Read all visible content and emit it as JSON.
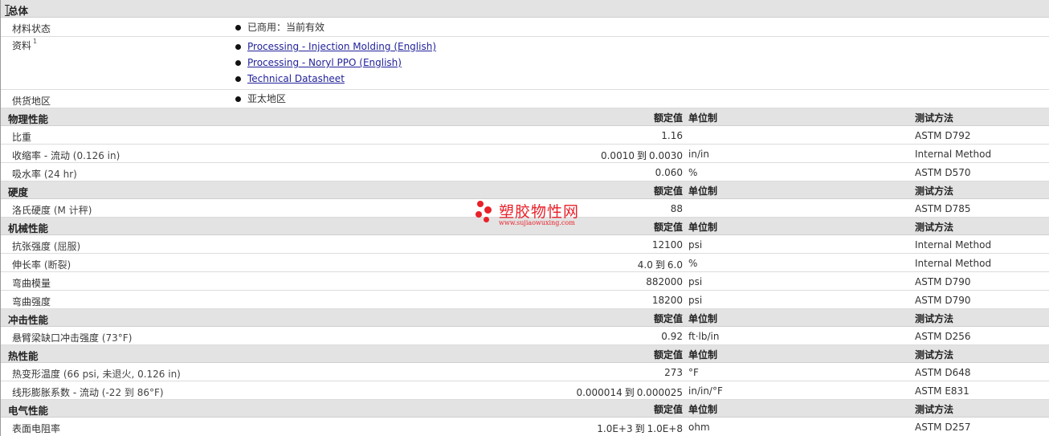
{
  "general": {
    "title": "总体",
    "rows": [
      {
        "name": "材料状态",
        "items": [
          {
            "text": "已商用：当前有效",
            "link": false
          }
        ]
      },
      {
        "name": "资料",
        "sup": "1",
        "items": [
          {
            "text": "Processing - Injection Molding (English)",
            "link": true
          },
          {
            "text": "Processing - Noryl PPO (English)",
            "link": true
          },
          {
            "text": "Technical Datasheet",
            "link": true
          }
        ]
      },
      {
        "name": "供货地区",
        "items": [
          {
            "text": "亚太地区",
            "link": false
          }
        ]
      }
    ]
  },
  "columns": {
    "value": "额定值",
    "unit": "单位制",
    "test": "测试方法"
  },
  "range_word": "到",
  "sections": [
    {
      "title": "物理性能",
      "rows": [
        {
          "name": "比重",
          "value": "1.16",
          "unit": "",
          "test": "ASTM D792"
        },
        {
          "name": "收缩率 - 流动",
          "cond": "(0.126 in)",
          "value_from": "0.0010",
          "value_to": "0.0030",
          "unit": "in/in",
          "test": "Internal Method"
        },
        {
          "name": "吸水率",
          "cond": "(24 hr)",
          "value": "0.060",
          "unit": "%",
          "test": "ASTM D570"
        }
      ]
    },
    {
      "title": "硬度",
      "rows": [
        {
          "name": "洛氏硬度",
          "cond": "(M 计秤)",
          "value": "88",
          "unit": "",
          "test": "ASTM D785"
        }
      ]
    },
    {
      "title": "机械性能",
      "rows": [
        {
          "name": "抗张强度",
          "cond": "(屈服)",
          "value": "12100",
          "unit": "psi",
          "test": "Internal Method"
        },
        {
          "name": "伸长率",
          "cond": "(断裂)",
          "value_from": "4.0",
          "value_to": "6.0",
          "unit": "%",
          "test": "Internal Method"
        },
        {
          "name": "弯曲模量",
          "value": "882000",
          "unit": "psi",
          "test": "ASTM D790"
        },
        {
          "name": "弯曲强度",
          "value": "18200",
          "unit": "psi",
          "test": "ASTM D790"
        }
      ]
    },
    {
      "title": "冲击性能",
      "rows": [
        {
          "name": "悬臂梁缺口冲击强度",
          "cond": "(73°F)",
          "value": "0.92",
          "unit": "ft·lb/in",
          "test": "ASTM D256"
        }
      ]
    },
    {
      "title": "热性能",
      "rows": [
        {
          "name": "热变形温度",
          "cond": "(66 psi, 未退火, 0.126 in)",
          "value": "273",
          "unit": "°F",
          "test": "ASTM D648"
        },
        {
          "name": "线形膨胀系数 - 流动",
          "cond": "(-22 到 86°F)",
          "value_from": "0.000014",
          "value_to": "0.000025",
          "unit": "in/in/°F",
          "test": "ASTM E831"
        }
      ]
    },
    {
      "title": "电气性能",
      "rows": [
        {
          "name": "表面电阻率",
          "value_from": "1.0E+3",
          "value_to": "1.0E+8",
          "unit": "ohm",
          "test": "ASTM D257"
        }
      ]
    }
  ],
  "watermark": {
    "title": "塑胶物性网",
    "url": "www.sujiaowuxing.com",
    "color": "#e8212a"
  },
  "colors": {
    "header_bg": "#e3e3e3",
    "link": "#22229a"
  }
}
